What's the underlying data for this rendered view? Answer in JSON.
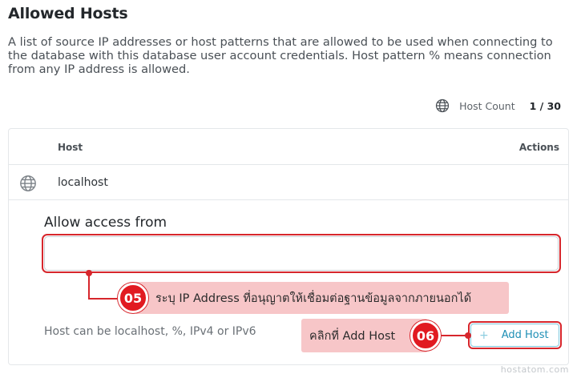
{
  "page": {
    "title": "Allowed Hosts",
    "description": "A list of source IP addresses or host patterns that are allowed to be used when connecting to the database with this database user account credentials. Host pattern % means connection from any IP address is allowed."
  },
  "host_count": {
    "icon": "globe-icon",
    "label": "Host Count",
    "value": "1 / 30"
  },
  "table": {
    "columns": [
      "Host",
      "Actions"
    ],
    "rows": [
      {
        "icon": "globe-icon",
        "host": "localhost"
      }
    ]
  },
  "form": {
    "label": "Allow access from",
    "input_value": "",
    "hint": "Host can be localhost, %, IPv4 or IPv6",
    "add_button": {
      "icon": "plus-icon",
      "label": "Add Host"
    }
  },
  "annotations": {
    "step5": {
      "number": "05",
      "text": "ระบุ IP Address ที่อนุญาตให้เชื่อมต่อฐานข้อมูลจากภายนอกได้"
    },
    "step6": {
      "number": "06",
      "text": "คลิกที่ Add Host"
    },
    "accent_color": "#d7262c",
    "callout_bg": "#f7c6c8"
  },
  "watermark": "hostatom.com"
}
